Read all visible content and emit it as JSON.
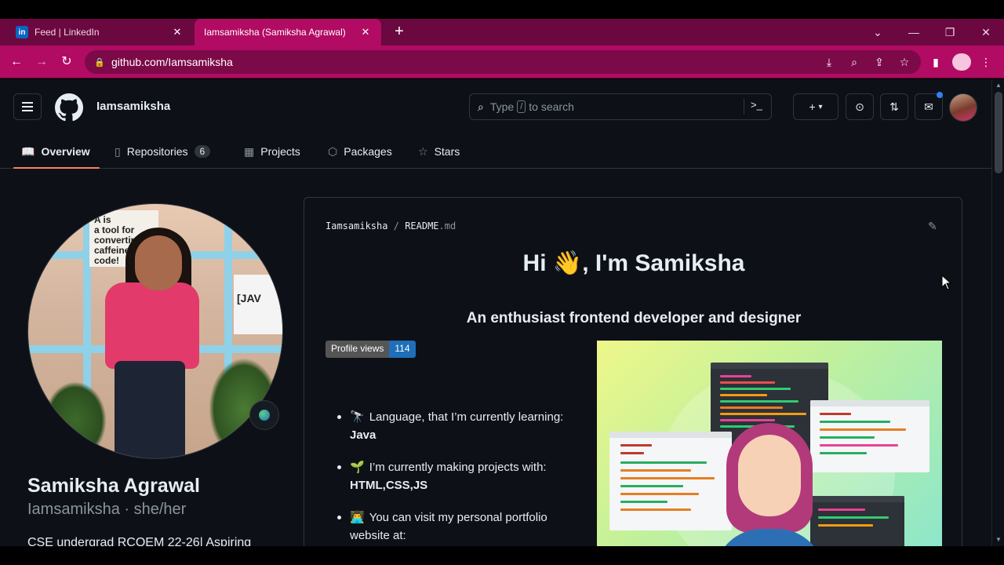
{
  "browser": {
    "tabs": [
      {
        "title": "Feed | LinkedIn",
        "favicon": "linkedin-icon",
        "active": false
      },
      {
        "title": "Iamsamiksha (Samiksha Agrawal)",
        "favicon": "github-icon",
        "active": true
      }
    ],
    "url": "github.com/Iamsamiksha",
    "theme_color": "#b10b63"
  },
  "github": {
    "header": {
      "username": "Iamsamiksha",
      "search_placeholder_pre": "Type",
      "search_key": "/",
      "search_placeholder_post": "to search"
    },
    "subnav": {
      "overview": "Overview",
      "repositories": "Repositories",
      "repositories_count": "6",
      "projects": "Projects",
      "packages": "Packages",
      "stars": "Stars"
    },
    "profile": {
      "full_name": "Samiksha Agrawal",
      "handle": "Iamsamiksha · she/her",
      "bio": "CSE undergrad RCOEM 22-26| Aspiring"
    },
    "readme": {
      "path_user": "Iamsamiksha",
      "path_sep": "/",
      "path_file": "README",
      "path_ext": ".md",
      "greeting": "Hi 👋, I'm Samiksha",
      "tagline": "An enthusiast frontend developer and designer",
      "badge_label": "Profile views",
      "badge_count": "114",
      "items": [
        {
          "emoji": "🔭",
          "text": "Language, that I’m currently learning:",
          "bold": "Java"
        },
        {
          "emoji": "🌱",
          "text": "I’m currently making projects with:",
          "bold": "HTML,CSS,JS"
        },
        {
          "emoji": "👨‍💻",
          "text": "You can visit my personal portfolio website at:",
          "bold": ""
        }
      ]
    }
  }
}
